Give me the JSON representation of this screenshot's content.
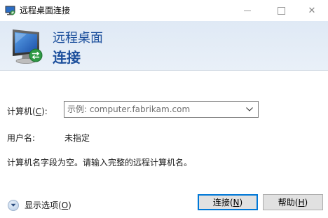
{
  "window": {
    "title": "远程桌面连接",
    "icon": "remote-desktop-icon",
    "controls": {
      "minimize": "minimize-icon",
      "maximize": "maximize-icon",
      "close": "✕"
    }
  },
  "banner": {
    "line1": "远程桌面",
    "line2": "连接",
    "icon": "monitor-connection-icon"
  },
  "form": {
    "computer_label_pre": "计算机(",
    "computer_label_key": "C",
    "computer_label_post": "):",
    "computer_placeholder": "示例: computer.fabrikam.com",
    "computer_value": "",
    "user_label": "用户名:",
    "user_value": "未指定",
    "message": "计算机名字段为空。请输入完整的远程计算机名。"
  },
  "footer": {
    "options_pre": "显示选项(",
    "options_key": "O",
    "options_post": ")",
    "connect_pre": "连接(",
    "connect_key": "N",
    "connect_post": ")",
    "help_pre": "帮助(",
    "help_key": "H",
    "help_post": ")"
  },
  "colors": {
    "banner_text": "#1c4f9c",
    "banner_bg": "#dfe9f5",
    "default_button_border": "#0078d7"
  }
}
